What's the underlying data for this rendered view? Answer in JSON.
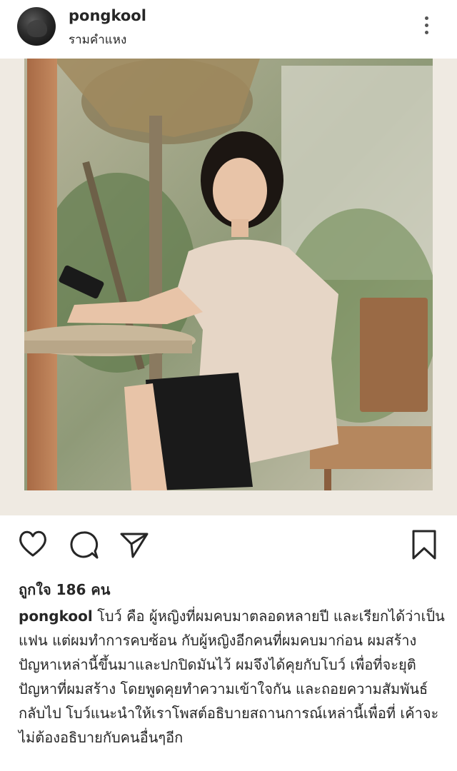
{
  "post": {
    "username": "pongkool",
    "location": "รามคำแหง",
    "likes": "ถูกใจ 186 คน",
    "caption": "โบว์ คือ ผู้หญิงที่ผมคบมาตลอดหลายปี และเรียกได้ว่าเป็นแฟน แต่ผมทำการคบซ้อน กับผู้หญิงอีกคนที่ผมคบมาก่อน ผมสร้างปัญหาเหล่านี้ขึ้นมาและปกปิดมันไว้ ผมจึงได้คุยกับโบว์ เพื่อที่จะยุติปัญหาที่ผมสร้าง โดยพูดคุยทำความเข้าใจกัน และถอยความสัมพันธ์กลับไป โบว์แนะนำให้เราโพสต์อธิบายสถานการณ์เหล่านี้เพื่อที่ เค้าจะไม่ต้องอธิบายกับคนอื่นๆอีก"
  },
  "icons": {
    "more": "more-vertical-icon",
    "like": "heart-icon",
    "comment": "comment-icon",
    "share": "send-icon",
    "save": "bookmark-icon"
  },
  "colors": {
    "text": "#262626",
    "background": "#ffffff",
    "photo_border": "#efeae2"
  }
}
